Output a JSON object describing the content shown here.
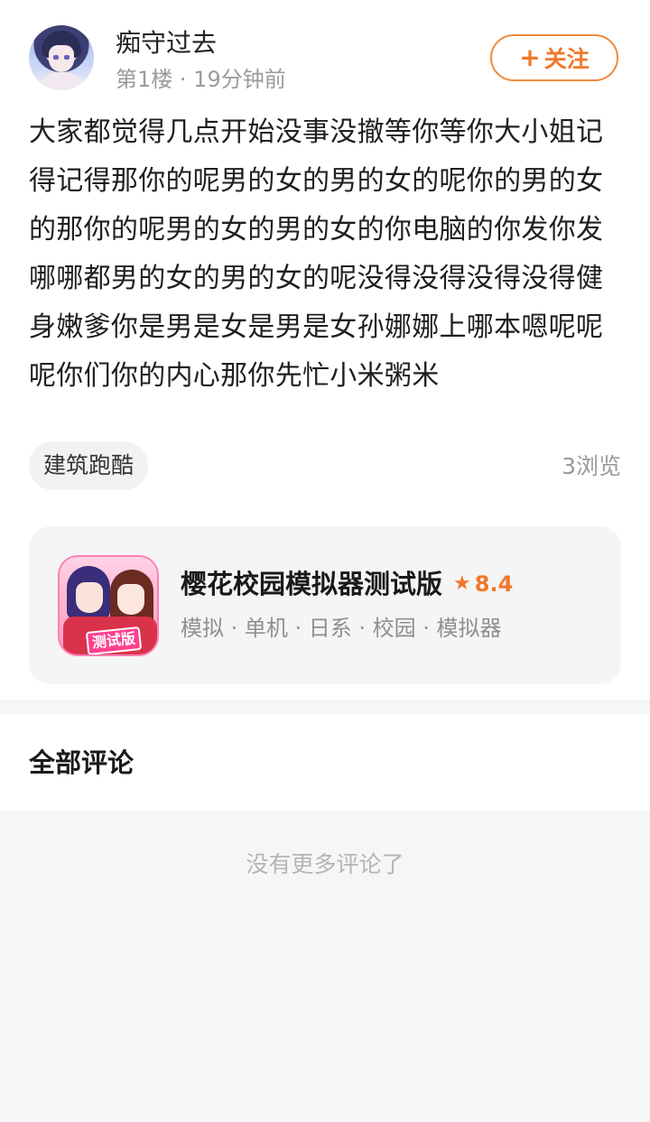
{
  "post": {
    "author": "痴守过去",
    "floor": "第1楼",
    "separator": " · ",
    "time": "19分钟前",
    "follow_label": "关注",
    "follow_icon": "plus-icon",
    "content": "大家都觉得几点开始没事没撤等你等你大小姐记得记得那你的呢男的女的男的女的呢你的男的女的那你的呢男的女的男的女的你电脑的你发你发哪哪都男的女的男的女的呢没得没得没得没得健身嫩爹你是男是女是男是女孙娜娜上哪本嗯呢呢呢你们你的内心那你先忙小米粥米",
    "tag": "建筑跑酷",
    "views": "3浏览"
  },
  "game": {
    "title": "樱花校园模拟器测试版",
    "rating": "8.4",
    "rating_icon": "star-icon",
    "tags": "模拟 · 单机 · 日系 · 校园 · 模拟器",
    "icon_badge": "测试版",
    "accent_color": "#f0782a"
  },
  "comments": {
    "title": "全部评论",
    "empty_text": "没有更多评论了"
  }
}
